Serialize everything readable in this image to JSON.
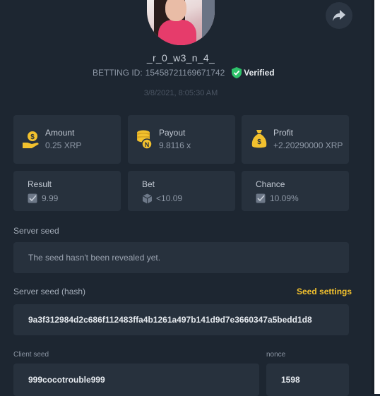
{
  "profile": {
    "username": "_r_0_w3_n_4_",
    "betting_id_label": "BETTING ID:",
    "betting_id": "15458721169671742",
    "verified_label": "Verified",
    "timestamp": "3/8/2021, 8:05:30 AM"
  },
  "stats": {
    "amount": {
      "label": "Amount",
      "value": "0.25 XRP"
    },
    "payout": {
      "label": "Payout",
      "value": "9.8116 x"
    },
    "profit": {
      "label": "Profit",
      "value": "+2.20290000 XRP"
    },
    "result": {
      "label": "Result",
      "value": "9.99"
    },
    "bet": {
      "label": "Bet",
      "value": "<10.09"
    },
    "chance": {
      "label": "Chance",
      "value": "10.09%"
    }
  },
  "server_seed": {
    "label": "Server seed",
    "value": "The seed hasn't been revealed yet."
  },
  "server_seed_hash": {
    "label": "Server seed (hash)",
    "settings_label": "Seed settings",
    "value": "9a3f312984d2c686f112483ffa4b1261a497b141d9d7e3660347a5bedd1d8"
  },
  "client_seed": {
    "label": "Client seed",
    "value": "999cocotrouble999"
  },
  "nonce": {
    "label": "nonce",
    "value": "1598"
  },
  "colors": {
    "background": "#1d2631",
    "card": "#27313d",
    "accent_gold": "#f2c12e",
    "verified_green": "#2ec26a"
  }
}
